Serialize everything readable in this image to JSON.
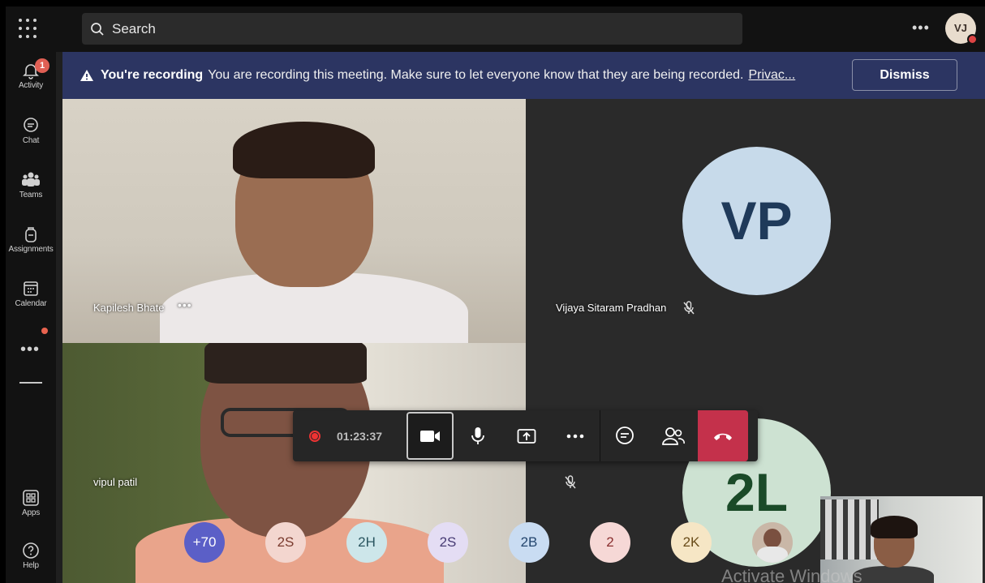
{
  "rail": {
    "items": [
      {
        "label": "Activity",
        "badge": "1"
      },
      {
        "label": "Chat"
      },
      {
        "label": "Teams"
      },
      {
        "label": "Assignments"
      },
      {
        "label": "Calendar"
      },
      {
        "label": "Apps"
      },
      {
        "label": "Help"
      }
    ],
    "more": "•••"
  },
  "topbar": {
    "search_placeholder": "Search",
    "more": "•••",
    "avatar_initials": "VJ"
  },
  "banner": {
    "title": "You're recording",
    "message": "You are recording this meeting. Make sure to let everyone know that they are being recorded.",
    "link": "Privac...",
    "dismiss": "Dismiss",
    "color": "#2c3562"
  },
  "participants": {
    "kapilesh": {
      "name": "Kapilesh Bhate",
      "more": "•••"
    },
    "vijaya": {
      "name": "Vijaya Sitaram Pradhan",
      "initials": "VP",
      "muted": true
    },
    "vipul": {
      "name": "vipul patil"
    },
    "zl": {
      "initials": "2L",
      "muted": true
    }
  },
  "controls": {
    "recording_time": "01:23:37",
    "hangup_color": "#c4314b"
  },
  "bubbles": [
    {
      "text": "+70",
      "bg": "#5b5fc7",
      "fg": "#ffffff"
    },
    {
      "text": "2S",
      "bg": "#f3d6cf",
      "fg": "#7a3b2e"
    },
    {
      "text": "2H",
      "bg": "#cde6ea",
      "fg": "#2a5560"
    },
    {
      "text": "2S",
      "bg": "#e4ddf4",
      "fg": "#473b74"
    },
    {
      "text": "2B",
      "bg": "#c9dcf2",
      "fg": "#24466e"
    },
    {
      "text": "2",
      "bg": "#f6d8d6",
      "fg": "#8a3030"
    },
    {
      "text": "2K",
      "bg": "#f6e6c5",
      "fg": "#6a4d1a"
    }
  ],
  "watermark": "Activate Windows"
}
